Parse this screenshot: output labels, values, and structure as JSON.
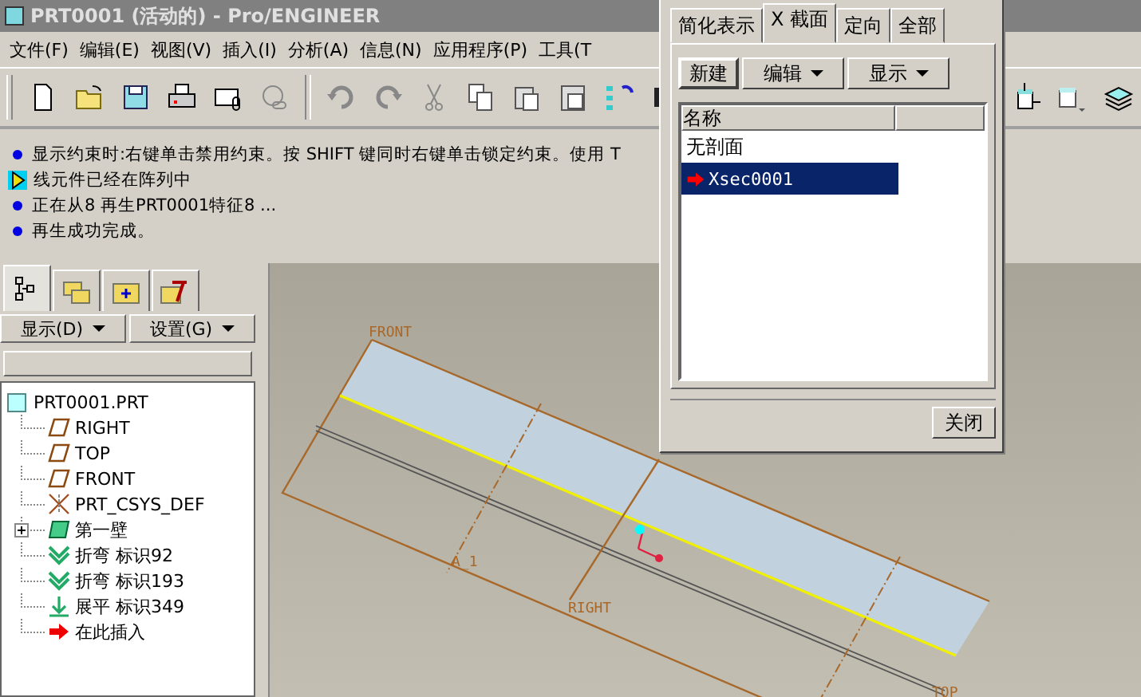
{
  "window": {
    "title": "PRT0001 (活动的) - Pro/ENGINEER"
  },
  "menu": [
    "文件(F)",
    "编辑(E)",
    "视图(V)",
    "插入(I)",
    "分析(A)",
    "信息(N)",
    "应用程序(P)",
    "工具(T"
  ],
  "messages": [
    {
      "kind": "info",
      "text": "显示约束时:右键单击禁用约束。按 SHIFT 键同时右键单击锁定约束。使用 T"
    },
    {
      "kind": "warning",
      "text": "线元件已经在阵列中"
    },
    {
      "kind": "info",
      "text": "正在从8 再生PRT0001特征8 ..."
    },
    {
      "kind": "info",
      "text": "再生成功完成。"
    }
  ],
  "navigator": {
    "tabs": [
      {
        "kind": "tree",
        "selected": true
      },
      {
        "kind": "folders",
        "selected": false
      },
      {
        "kind": "favorites",
        "selected": false
      },
      {
        "kind": "tools",
        "selected": false
      }
    ],
    "buttons": [
      "显示(D)",
      "设置(G)"
    ],
    "tree": {
      "label": "PRT0001.PRT",
      "kind": "part",
      "children": [
        {
          "label": "RIGHT",
          "kind": "plane"
        },
        {
          "label": "TOP",
          "kind": "plane"
        },
        {
          "label": "FRONT",
          "kind": "plane"
        },
        {
          "label": "PRT_CSYS_DEF",
          "kind": "csys"
        },
        {
          "label": "第一壁",
          "kind": "wall",
          "expanded": false
        },
        {
          "label": "折弯 标识92",
          "kind": "bend"
        },
        {
          "label": "折弯 标识193",
          "kind": "bend"
        },
        {
          "label": "展平 标识349",
          "kind": "unbend"
        },
        {
          "label": "在此插入",
          "kind": "insert"
        }
      ]
    }
  },
  "canvas": {
    "datum_labels": [
      "FRONT",
      "A_1",
      "RIGHT",
      "TOP"
    ]
  },
  "dialog": {
    "tabs": [
      {
        "label": "简化表示",
        "selected": false
      },
      {
        "label": "X 截面",
        "selected": true
      },
      {
        "label": "定向",
        "selected": false
      },
      {
        "label": "全部",
        "selected": false
      }
    ],
    "buttons": [
      {
        "label": "新建",
        "kind": "plain"
      },
      {
        "label": "编辑",
        "kind": "menu"
      },
      {
        "label": "显示",
        "kind": "menu"
      }
    ],
    "list": {
      "columns": [
        "名称"
      ],
      "rows": [
        {
          "name": "无剖面",
          "selected": false,
          "active": false
        },
        {
          "name": "Xsec0001",
          "selected": true,
          "active": true
        }
      ]
    },
    "close": "关闭"
  }
}
